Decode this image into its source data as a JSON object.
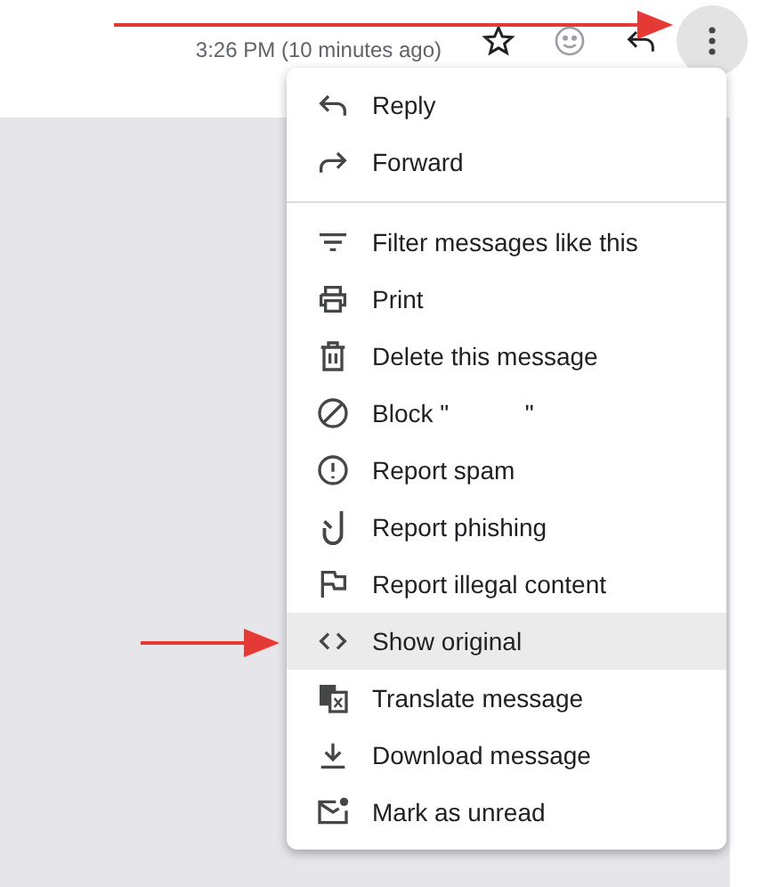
{
  "header": {
    "timestamp": "3:26 PM (10 minutes ago)",
    "more_button": {
      "selected": true
    }
  },
  "menu": {
    "groups": [
      {
        "items": [
          {
            "label": "Reply",
            "kind": "reply",
            "selected": false
          },
          {
            "label": "Forward",
            "kind": "forward",
            "selected": false
          }
        ]
      },
      {
        "items": [
          {
            "label": "Filter messages like this",
            "kind": "filter",
            "selected": false
          },
          {
            "label": "Print",
            "kind": "print",
            "selected": false
          },
          {
            "label": "Delete this message",
            "kind": "delete",
            "selected": false
          },
          {
            "label": "Block \"           \"",
            "kind": "block",
            "selected": false
          },
          {
            "label": "Report spam",
            "kind": "spam",
            "selected": false
          },
          {
            "label": "Report phishing",
            "kind": "phishing",
            "selected": false
          },
          {
            "label": "Report illegal content",
            "kind": "flag",
            "selected": false
          },
          {
            "label": "Show original",
            "kind": "code",
            "selected": true
          },
          {
            "label": "Translate message",
            "kind": "translate",
            "selected": false
          },
          {
            "label": "Download message",
            "kind": "download",
            "selected": false
          },
          {
            "label": "Mark as unread",
            "kind": "unread",
            "selected": false
          }
        ]
      }
    ]
  }
}
